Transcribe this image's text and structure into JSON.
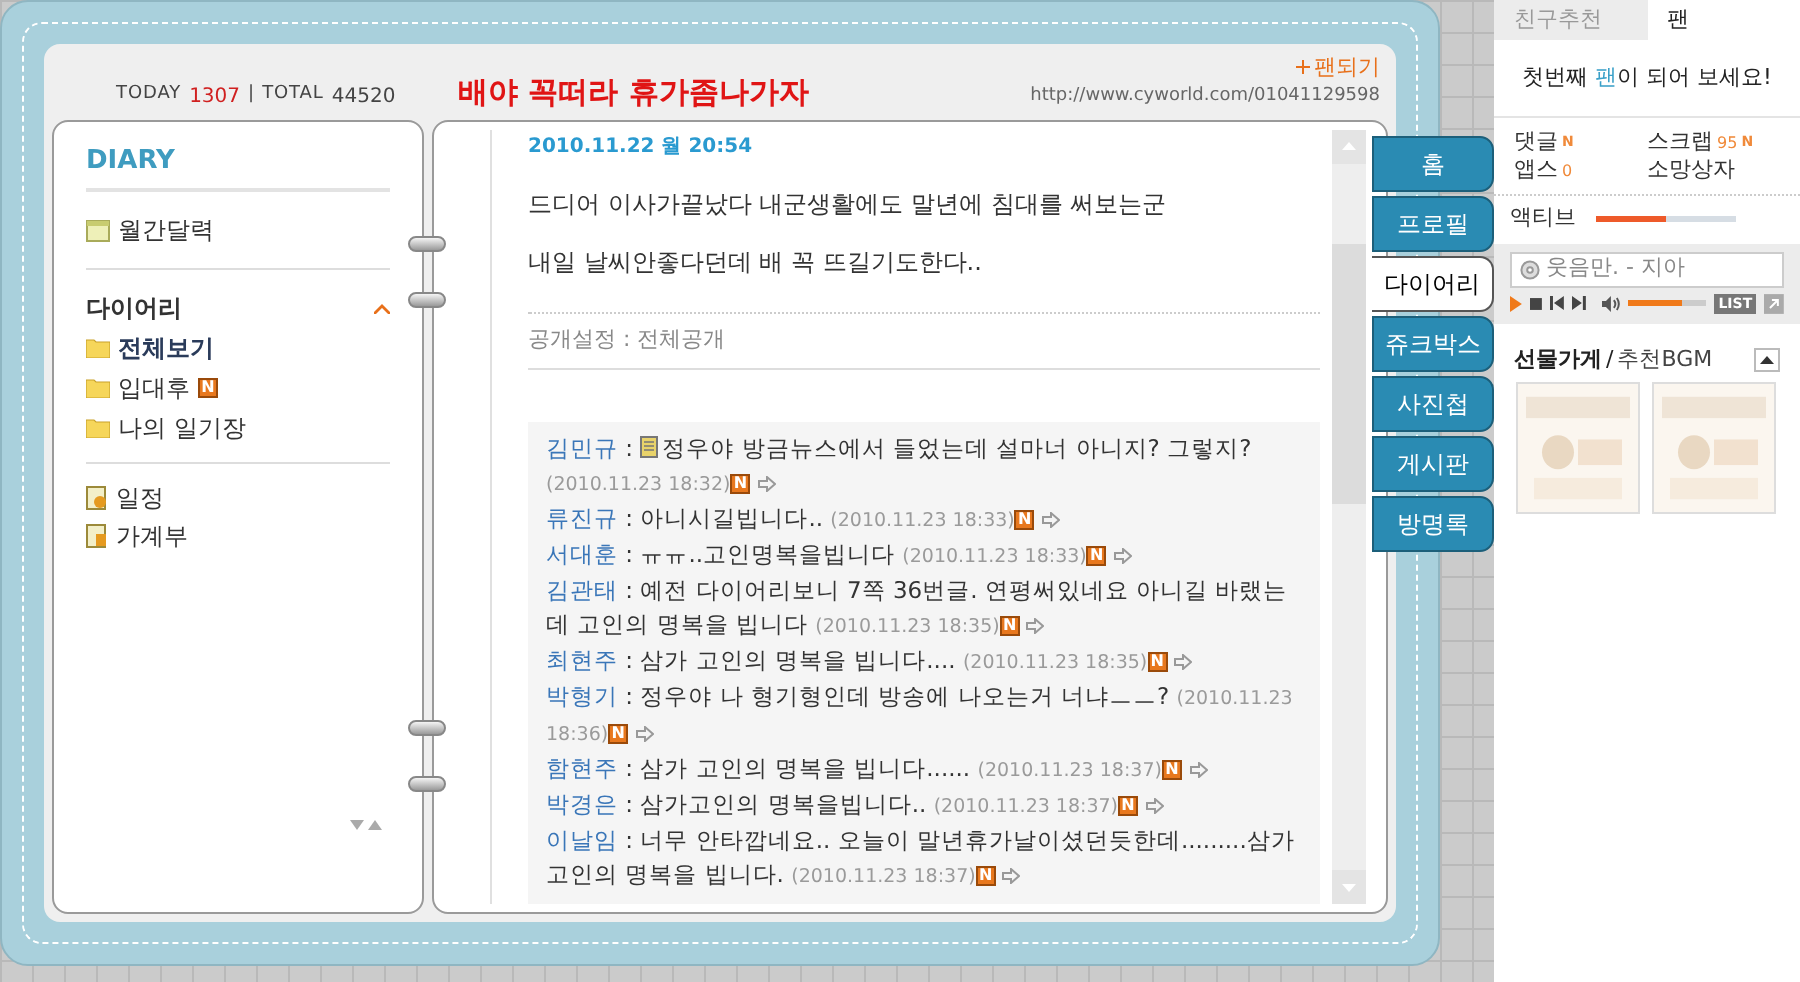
{
  "header": {
    "today_label": "TODAY",
    "today": "1307",
    "separator": "|",
    "total_label": "TOTAL",
    "total": "44520",
    "title": "배야 꼭떠라 휴가좀나가자",
    "fan_button": "팬되기",
    "url": "http://www.cyworld.com/01041129598"
  },
  "menu": {
    "heading": "DIARY",
    "calendar": "월간달력",
    "folder_group": {
      "label": "다이어리",
      "expanded": true,
      "children": [
        {
          "label": "전체보기",
          "selected": true
        },
        {
          "label": "입대후",
          "selected": false,
          "badge": "N"
        },
        {
          "label": "나의 일기장",
          "selected": false
        }
      ]
    },
    "tools": [
      {
        "label": "일정",
        "kind": "schedule"
      },
      {
        "label": "가계부",
        "kind": "ledger"
      }
    ]
  },
  "post": {
    "date": "2010.11.22 월 20:54",
    "paragraphs": [
      "드디어 이사가끝났다 내군생활에도 말년에 침대를 써보는군",
      "내일 날씨안좋다던데 배 꼭 뜨길기도한다.."
    ],
    "visibility": "공개설정 : 전체공개",
    "comment_separator": ":",
    "comments": [
      {
        "name": "김민규",
        "memo_icon": true,
        "text": "정우야 방금뉴스에서 들었는데 설마너 아니지? 그렇지?",
        "time": "(2010.11.23 18:32)",
        "badge": "N"
      },
      {
        "name": "류진규",
        "memo_icon": false,
        "text": "아니시길빕니다..",
        "time": "(2010.11.23 18:33)",
        "badge": "N"
      },
      {
        "name": "서대훈",
        "memo_icon": false,
        "text": "ㅠㅠ..고인명복을빕니다",
        "time": "(2010.11.23 18:33)",
        "badge": "N"
      },
      {
        "name": "김관태",
        "memo_icon": false,
        "text": "예전 다이어리보니 7쪽 36번글. 연평써있네요 아니길 바랬는데 고인의 명복을 빕니다",
        "time": "(2010.11.23 18:35)",
        "badge": "N"
      },
      {
        "name": "최현주",
        "memo_icon": false,
        "text": "삼가 고인의 명복을 빕니다....",
        "time": "(2010.11.23 18:35)",
        "badge": "N"
      },
      {
        "name": "박형기",
        "memo_icon": false,
        "text": "정우야 나 형기형인데 방송에 나오는거 너냐ㅡㅡ?",
        "time": "(2010.11.23 18:36)",
        "badge": "N"
      },
      {
        "name": "함현주",
        "memo_icon": false,
        "text": "삼가 고인의 명복을 빕니다......",
        "time": "(2010.11.23 18:37)",
        "badge": "N"
      },
      {
        "name": "박경은",
        "memo_icon": false,
        "text": "삼가고인의 명복을빕니다..",
        "time": "(2010.11.23 18:37)",
        "badge": "N"
      },
      {
        "name": "이날임",
        "memo_icon": false,
        "text": "너무 안타깝네요.. 오늘이 말년휴가날이셨던듯한데.........삼가고인의 명복을 빕니다.",
        "time": "(2010.11.23 18:37)",
        "badge": "N"
      }
    ]
  },
  "nav_tabs": [
    {
      "label": "홈",
      "selected": false
    },
    {
      "label": "프로필",
      "selected": false
    },
    {
      "label": "다이어리",
      "selected": true
    },
    {
      "label": "쥬크박스",
      "selected": false
    },
    {
      "label": "사진첩",
      "selected": false
    },
    {
      "label": "게시판",
      "selected": false
    },
    {
      "label": "방명록",
      "selected": false
    }
  ],
  "side": {
    "tabs": [
      {
        "label": "친구추천",
        "selected": false
      },
      {
        "label": "팬",
        "selected": true
      }
    ],
    "fan_prompt": {
      "before": "첫번째 ",
      "highlight": "팬",
      "after": "이 되어 보세요!"
    },
    "stats": [
      {
        "label": "댓글",
        "badge": "N"
      },
      {
        "label": "스크랩",
        "count": "95",
        "badge": "N"
      },
      {
        "label": "앱스",
        "count": "0"
      },
      {
        "label": "소망상자"
      }
    ],
    "activity": {
      "label": "액티브",
      "level": 0.5
    },
    "player": {
      "track": "웃음만. - 지아",
      "volume": {
        "level": 0.7
      },
      "list": "LIST"
    },
    "gifts": {
      "title": "선물가게",
      "separator": "/",
      "subtitle": "추천BGM"
    }
  }
}
